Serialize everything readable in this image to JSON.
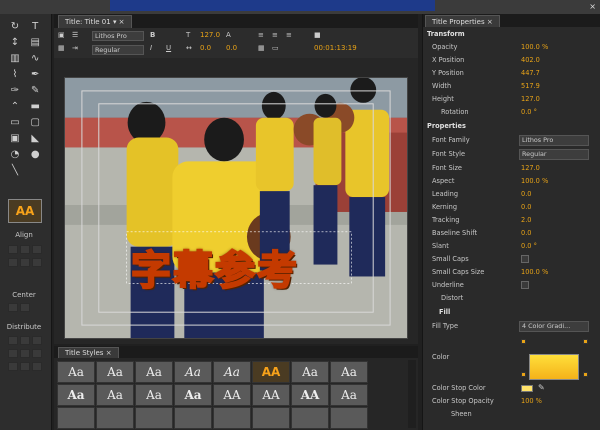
{
  "window": {
    "close": "×"
  },
  "tools": {
    "align_label": "Align",
    "center_label": "Center",
    "distribute_label": "Distribute",
    "aa_preview": "AA"
  },
  "title_tab": "Title: Title 01",
  "toolbar": {
    "font_family": "Lithos Pro",
    "font_style": "Regular",
    "bold": "B",
    "italic": "I",
    "underline": "U",
    "font_size": "127.0",
    "kerning": "0.0",
    "leading": "0.0",
    "timecode": "00:01:13:19"
  },
  "subtitle_text": "字幕参考",
  "styles_tab": "Title Styles",
  "styles_row1": [
    "Aa",
    "Aa",
    "Aa",
    "Aa",
    "Aa",
    "AA",
    "Aa",
    "Aa"
  ],
  "styles_row2": [
    "Aa",
    "Aa",
    "Aa",
    "Aa",
    "AA",
    "AA",
    "AA",
    "Aa"
  ],
  "props_tab": "Title Properties",
  "transform": {
    "header": "Transform",
    "opacity_label": "Opacity",
    "opacity": "100.0 %",
    "x_label": "X Position",
    "x": "402.0",
    "y_label": "Y Position",
    "y": "447.7",
    "width_label": "Width",
    "width": "517.9",
    "height_label": "Height",
    "height": "127.0",
    "rotation_label": "Rotation",
    "rotation": "0.0 °"
  },
  "properties": {
    "header": "Properties",
    "family_label": "Font Family",
    "family": "Lithos Pro",
    "style_label": "Font Style",
    "style": "Regular",
    "size_label": "Font Size",
    "size": "127.0",
    "aspect_label": "Aspect",
    "aspect": "100.0 %",
    "leading_label": "Leading",
    "leading": "0.0",
    "kerning_label": "Kerning",
    "kerning": "0.0",
    "tracking_label": "Tracking",
    "tracking": "2.0",
    "baseline_label": "Baseline Shift",
    "baseline": "0.0",
    "slant_label": "Slant",
    "slant": "0.0 °",
    "smallcaps_label": "Small Caps",
    "smallcaps_size_label": "Small Caps Size",
    "smallcaps_size": "100.0 %",
    "underline_label": "Underline",
    "distort_label": "Distort"
  },
  "fill": {
    "header": "Fill",
    "type_label": "Fill Type",
    "type": "4 Color Gradi...",
    "color_label": "Color",
    "stop_color_label": "Color Stop Color",
    "stop_opacity_label": "Color Stop Opacity",
    "stop_opacity": "100 %",
    "sheen_label": "Sheen"
  }
}
